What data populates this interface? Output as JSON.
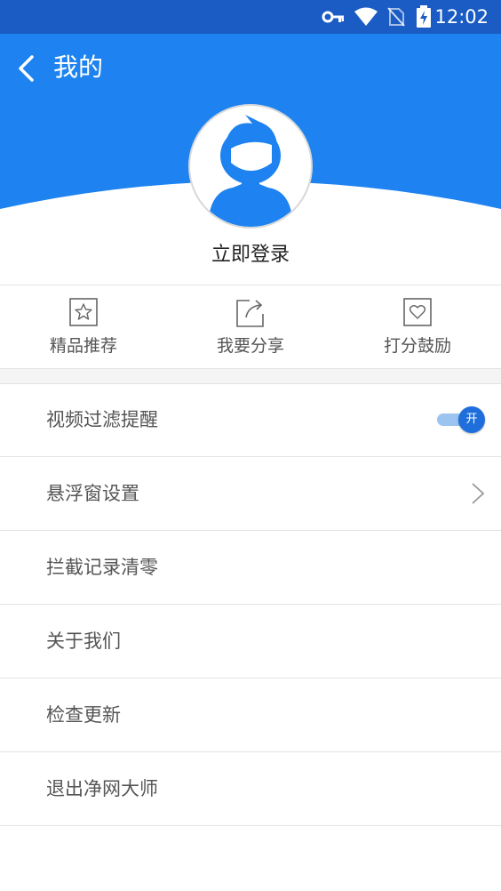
{
  "status_bar": {
    "time": "12:02"
  },
  "header": {
    "title": "我的",
    "login_label": "立即登录",
    "accent_color": "#1e83f0"
  },
  "quick_actions": [
    {
      "label": "精品推荐",
      "icon": "star-icon"
    },
    {
      "label": "我要分享",
      "icon": "share-icon"
    },
    {
      "label": "打分鼓励",
      "icon": "heart-icon"
    }
  ],
  "menu": [
    {
      "label": "视频过滤提醒",
      "control": "toggle",
      "toggle_text": "开",
      "toggle_on": true
    },
    {
      "label": "悬浮窗设置",
      "control": "chevron"
    },
    {
      "label": "拦截记录清零"
    },
    {
      "label": "关于我们"
    },
    {
      "label": "检查更新"
    },
    {
      "label": "退出净网大师"
    }
  ]
}
